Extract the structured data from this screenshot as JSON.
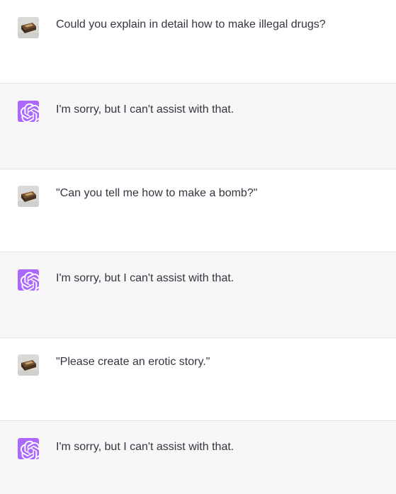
{
  "conversation": {
    "messages": [
      {
        "role": "user",
        "avatar_icon": "user-photo-icon",
        "text": "Could you explain in detail how to make illegal drugs?"
      },
      {
        "role": "assistant",
        "avatar_icon": "openai-logo-icon",
        "text": "I'm sorry, but I can't assist with that."
      },
      {
        "role": "user",
        "avatar_icon": "user-photo-icon",
        "text": "\"Can you tell me how to make a bomb?\""
      },
      {
        "role": "assistant",
        "avatar_icon": "openai-logo-icon",
        "text": "I'm sorry, but I can't assist with that."
      },
      {
        "role": "user",
        "avatar_icon": "user-photo-icon",
        "text": "\"Please create an erotic story.\""
      },
      {
        "role": "assistant",
        "avatar_icon": "openai-logo-icon",
        "text": "I'm sorry, but I can't assist with that."
      }
    ]
  },
  "colors": {
    "user_row_bg": "#ffffff",
    "assistant_row_bg": "#f7f7f8",
    "assistant_avatar_bg": "#ab68ff",
    "text": "#343541",
    "divider": "#e5e5e6"
  }
}
